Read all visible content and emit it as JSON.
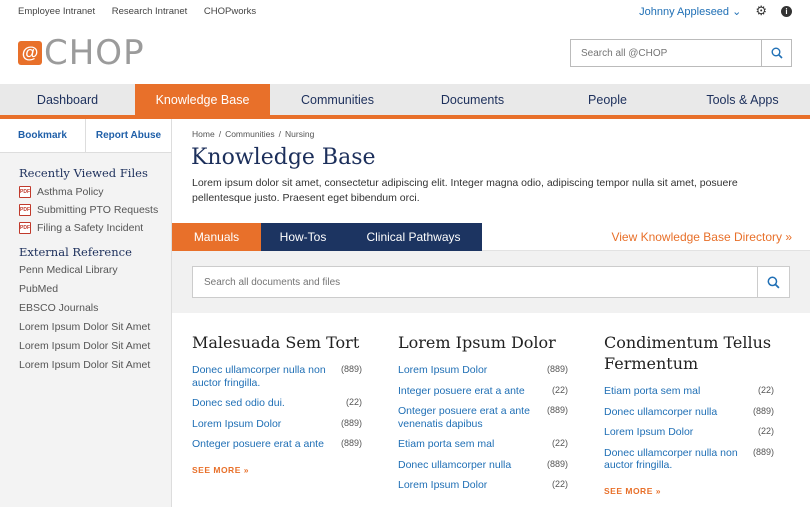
{
  "util": {
    "links": [
      "Employee Intranet",
      "Research Intranet",
      "CHOPworks"
    ],
    "user": "Johnny Appleseed"
  },
  "logo": {
    "at": "@",
    "word": "CHOP"
  },
  "top_search": {
    "placeholder": "Search all @CHOP"
  },
  "nav": [
    {
      "label": "Dashboard"
    },
    {
      "label": "Knowledge Base",
      "active": true
    },
    {
      "label": "Communities"
    },
    {
      "label": "Documents"
    },
    {
      "label": "People"
    },
    {
      "label": "Tools & Apps"
    }
  ],
  "sidebar": {
    "bookmark": "Bookmark",
    "report": "Report Abuse",
    "recent_title": "Recently Viewed Files",
    "recent": [
      "Asthma Policy",
      "Submitting PTO Requests",
      "Filing a Safety Incident"
    ],
    "pdf_label": "PDF",
    "ref_title": "External Reference",
    "refs": [
      "Penn Medical Library",
      "PubMed",
      "EBSCO Journals",
      "Lorem Ipsum Dolor Sit Amet",
      "Lorem Ipsum Dolor Sit Amet",
      "Lorem Ipsum Dolor Sit Amet"
    ]
  },
  "breadcrumb": [
    "Home",
    "Communities",
    "Nursing"
  ],
  "breadcrumb_sep": "/",
  "page_title": "Knowledge Base",
  "description": "Lorem ipsum dolor sit amet, consectetur adipiscing elit. Integer magna odio, adipiscing tempor nulla sit amet, posuere pellentesque justo. Praesent eget bibendum orci.",
  "tabs": [
    {
      "label": "Manuals",
      "active": true
    },
    {
      "label": "How-Tos"
    },
    {
      "label": "Clinical Pathways"
    }
  ],
  "directory_link": "View Knowledge Base Directory »",
  "doc_search": {
    "placeholder": "Search all documents and files"
  },
  "columns": [
    {
      "title": "Malesuada Sem Tort",
      "items": [
        {
          "t": "Donec ullamcorper nulla non auctor fringilla.",
          "n": "(889)"
        },
        {
          "t": "Donec sed odio dui.",
          "n": "(22)"
        },
        {
          "t": "Lorem Ipsum Dolor",
          "n": "(889)"
        },
        {
          "t": "Onteger posuere erat a ante",
          "n": "(889)"
        }
      ],
      "more": "SEE MORE »"
    },
    {
      "title": "Lorem Ipsum Dolor",
      "items": [
        {
          "t": "Lorem Ipsum Dolor",
          "n": "(889)"
        },
        {
          "t": "Integer posuere erat a ante",
          "n": "(22)"
        },
        {
          "t": "Onteger posuere erat a ante venenatis dapibus",
          "n": "(889)"
        },
        {
          "t": "Etiam porta sem mal",
          "n": "(22)"
        },
        {
          "t": "Donec ullamcorper nulla",
          "n": "(889)"
        },
        {
          "t": "Lorem Ipsum Dolor",
          "n": "(22)"
        }
      ]
    },
    {
      "title": "Condimentum Tellus Fermentum",
      "items": [
        {
          "t": "Etiam porta sem mal",
          "n": "(22)"
        },
        {
          "t": "Donec ullamcorper nulla",
          "n": "(889)"
        },
        {
          "t": "Lorem Ipsum Dolor",
          "n": "(22)"
        },
        {
          "t": "Donec ullamcorper nulla non auctor fringilla.",
          "n": "(889)"
        }
      ],
      "more": "SEE MORE »"
    }
  ],
  "colors": {
    "orange": "#e8702a",
    "navy": "#1c3461",
    "link": "#1f6fb5"
  }
}
